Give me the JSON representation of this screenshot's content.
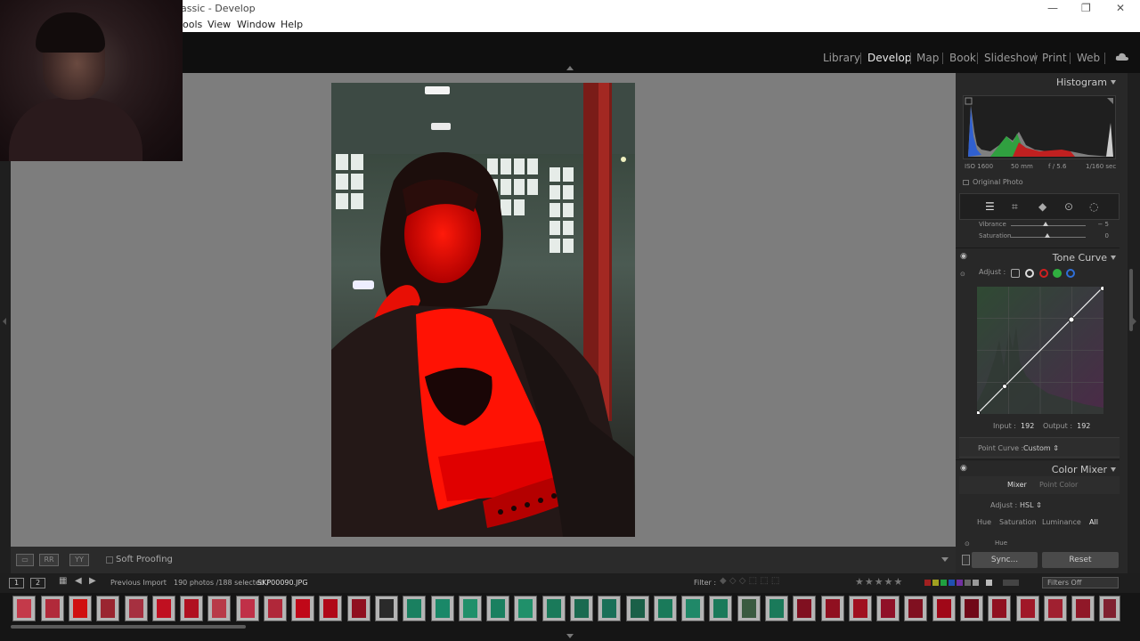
{
  "window": {
    "title": "assic - Develop",
    "minimize": "—",
    "restore": "❐",
    "close": "✕"
  },
  "menu": [
    "ools",
    "View",
    "Window",
    "Help"
  ],
  "modules": {
    "items": [
      "Library",
      "Develop",
      "Map",
      "Book",
      "Slideshow",
      "Print",
      "Web"
    ],
    "active": "Develop"
  },
  "toolbar": {
    "soft_proofing": "Soft Proofing",
    "view_icons": [
      "▭",
      "RR",
      "YY"
    ]
  },
  "right_panel": {
    "histogram_label": "Histogram",
    "hist_meta": [
      "ISO 1600",
      "50 mm",
      "f / 5.6",
      "1/160 sec"
    ],
    "original_photo": "Original Photo",
    "vibrance_label": "Vibrance",
    "vibrance_value": "− 5",
    "saturation_label": "Saturation",
    "saturation_value": "0",
    "tone_curve_label": "Tone Curve",
    "adjust_label": "Adjust :",
    "input_label": "Input :",
    "input_value": "192",
    "output_label": "Output :",
    "output_value": "192",
    "point_curve_label": "Point Curve :",
    "point_curve_value": "Custom ⇕",
    "color_mixer_label": "Color Mixer",
    "mixer_tab": "Mixer",
    "point_color_tab": "Point Color",
    "mixer_adjust_label": "Adjust :",
    "mixer_adjust_value": "HSL ⇕",
    "hsl_tabs": [
      "Hue",
      "Saturation",
      "Luminance",
      "All"
    ],
    "hue_label": "Hue"
  },
  "sync": {
    "sync_label": "Sync...",
    "reset_label": "Reset"
  },
  "filmbar": {
    "page1": "1",
    "page2": "2",
    "source": "Previous Import",
    "count": "190 photos /188 selected /",
    "filename": "SKP00090.JPG",
    "filter_label": "Filter :",
    "stars": "★★★★★",
    "filters_off": "Filters Off"
  },
  "colors": {
    "accent_red": "#e00000",
    "panel_bg": "#282828",
    "canvas_bg": "#7d7d7d"
  }
}
